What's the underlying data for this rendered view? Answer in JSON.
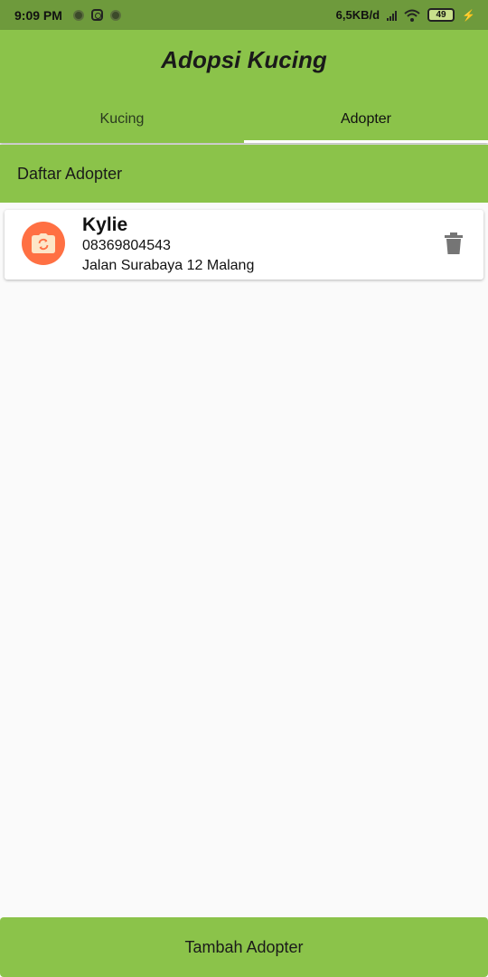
{
  "status_bar": {
    "time": "9:09 PM",
    "network_speed": "6,5KB/d",
    "battery_level": "49",
    "icons": [
      "notification-dot-icon",
      "instagram-icon",
      "notification-dot-icon",
      "signal-icon",
      "wifi-icon",
      "battery-icon",
      "charging-icon"
    ]
  },
  "app_bar": {
    "title": "Adopsi Kucing"
  },
  "tabs": [
    {
      "label": "Kucing",
      "active": false
    },
    {
      "label": "Adopter",
      "active": true
    }
  ],
  "section": {
    "title": "Daftar Adopter"
  },
  "adopters": [
    {
      "name": "Kylie",
      "phone": "08369804543",
      "address": "Jalan Surabaya 12 Malang",
      "avatar_icon": "camera-switch-icon",
      "action_icon": "trash-icon"
    }
  ],
  "footer": {
    "add_button_label": "Tambah Adopter"
  },
  "colors": {
    "primary": "#8bc34a",
    "status_bar": "#6e9a3c",
    "avatar": "#ff7043",
    "background": "#fafafa"
  }
}
